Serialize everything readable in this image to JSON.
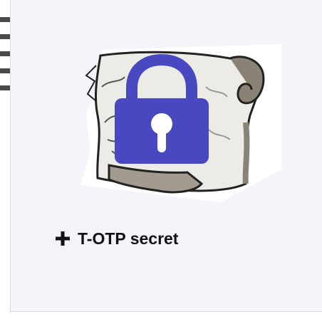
{
  "add_secret_card": {
    "label": "T-OTP secret",
    "icon": "plus-icon",
    "illustration": {
      "background_icon": "scroll-map-icon",
      "foreground_icon": "padlock-icon",
      "padlock_color": "#4848c0"
    }
  }
}
